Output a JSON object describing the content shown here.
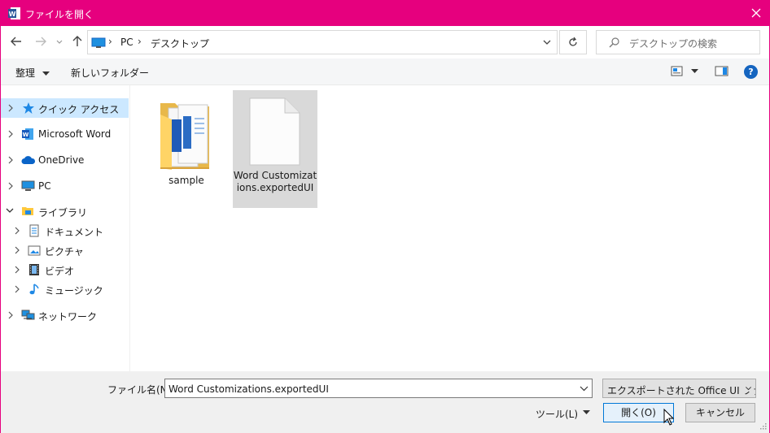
{
  "window": {
    "title": "ファイルを開く",
    "app_icon": "word-icon",
    "accent": "#e6007e"
  },
  "nav": {
    "back_icon": "back-arrow-icon",
    "forward_icon": "forward-arrow-icon",
    "recent_icon": "chevron-down-icon",
    "up_icon": "up-arrow-icon",
    "address": [
      "PC",
      "デスクトップ"
    ],
    "search_placeholder": "デスクトップの検索"
  },
  "toolbar": {
    "organize_label": "整理",
    "new_folder_label": "新しいフォルダー",
    "help_label": "?"
  },
  "sidebar": {
    "items": [
      {
        "label": "クイック アクセス",
        "icon": "star-icon",
        "selected": true
      },
      {
        "label": "Microsoft Word",
        "icon": "word-icon"
      },
      {
        "label": "OneDrive",
        "icon": "cloud-icon"
      },
      {
        "label": "PC",
        "icon": "computer-icon"
      },
      {
        "label": "ライブラリ",
        "icon": "library-folder-icon",
        "expanded": true
      },
      {
        "label": "ドキュメント",
        "icon": "document-icon"
      },
      {
        "label": "ピクチャ",
        "icon": "picture-icon"
      },
      {
        "label": "ビデオ",
        "icon": "video-icon"
      },
      {
        "label": "ミュージック",
        "icon": "music-icon"
      },
      {
        "label": "ネットワーク",
        "icon": "network-icon"
      }
    ]
  },
  "files": [
    {
      "name": "sample",
      "icon": "folder-icon"
    },
    {
      "name": "Word Customizations.exportedUI",
      "icon": "file-icon",
      "selected": true
    }
  ],
  "footer": {
    "filename_label": "ファイル名(N):",
    "filename_value": "Word Customizations.exportedUI",
    "filetype_value": "エクスポートされた Office UI ファイル",
    "tools_label": "ツール(L)",
    "open_label": "開く(O)",
    "cancel_label": "キャンセル"
  }
}
